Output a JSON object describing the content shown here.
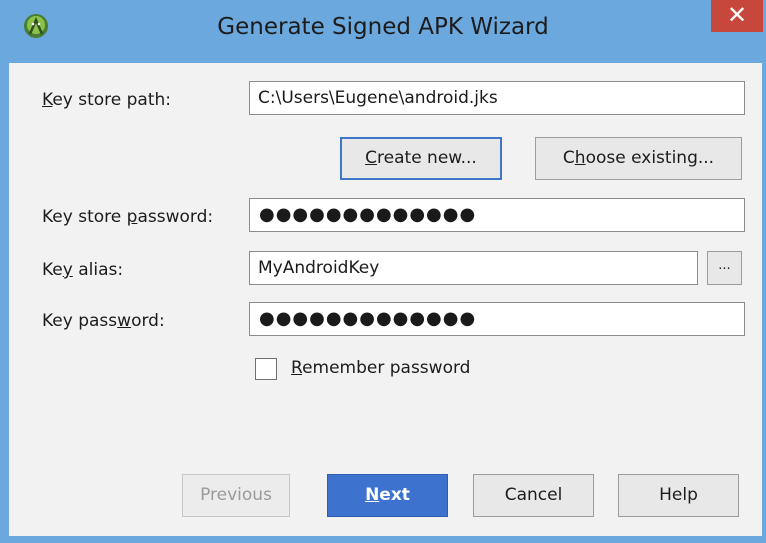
{
  "window": {
    "title": "Generate Signed APK Wizard",
    "close_glyph": "✕"
  },
  "form": {
    "keystore_path": {
      "label_pre": "",
      "label_key": "K",
      "label_post": "ey store path:",
      "value": "C:\\Users\\Eugene\\android.jks"
    },
    "create_new": {
      "key": "C",
      "rest": "reate new..."
    },
    "choose_existing": {
      "pre": "C",
      "key": "h",
      "rest": "oose existing..."
    },
    "keystore_password": {
      "label_pre": "Key store ",
      "label_key": "p",
      "label_post": "assword:",
      "value": "●●●●●●●●●●●●●"
    },
    "key_alias": {
      "label_pre": "Ke",
      "label_key": "y",
      "label_post": " alias:",
      "value": "MyAndroidKey",
      "browse_label": "..."
    },
    "key_password": {
      "label_pre": "Key pass",
      "label_key": "w",
      "label_post": "ord:",
      "value": "●●●●●●●●●●●●●"
    },
    "remember": {
      "key": "R",
      "rest": "emember password",
      "checked": false
    }
  },
  "buttons": {
    "previous": "Previous",
    "next_key": "N",
    "next_rest": "ext",
    "cancel": "Cancel",
    "help": "Help"
  },
  "colors": {
    "titlebar": "#6aa8dd",
    "close": "#c7473c",
    "primary": "#3d73cf",
    "android_green": "#8bc34a"
  },
  "icons": {
    "app": "android-studio-icon",
    "close": "close-icon"
  }
}
